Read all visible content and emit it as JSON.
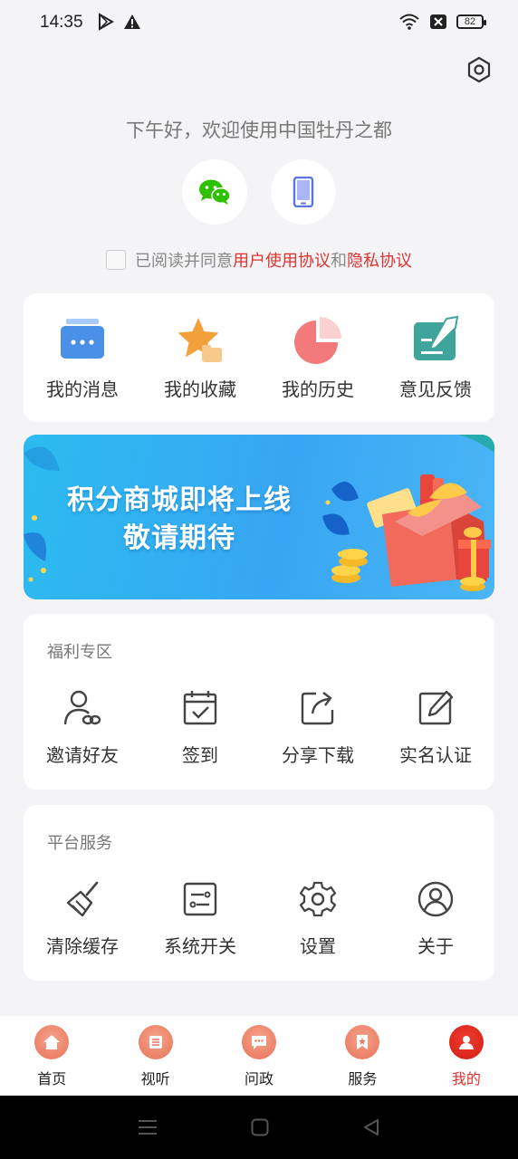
{
  "status": {
    "time": "14:35",
    "battery": "82"
  },
  "greeting": "下午好，欢迎使用中国牡丹之都",
  "agreement": {
    "prefix": "已阅读并同意",
    "user_agreement": "用户使用协议",
    "and": "和",
    "privacy": "隐私协议"
  },
  "quick": [
    {
      "label": "我的消息",
      "icon": "message-icon"
    },
    {
      "label": "我的收藏",
      "icon": "star-folder-icon"
    },
    {
      "label": "我的历史",
      "icon": "pie-history-icon"
    },
    {
      "label": "意见反馈",
      "icon": "feedback-icon"
    }
  ],
  "banner": {
    "line1": "积分商城即将上线",
    "line2": "敬请期待"
  },
  "welfare": {
    "title": "福利专区",
    "items": [
      {
        "label": "邀请好友",
        "icon": "invite-friend-icon"
      },
      {
        "label": "签到",
        "icon": "calendar-check-icon"
      },
      {
        "label": "分享下载",
        "icon": "share-icon"
      },
      {
        "label": "实名认证",
        "icon": "edit-icon"
      }
    ]
  },
  "platform": {
    "title": "平台服务",
    "items": [
      {
        "label": "清除缓存",
        "icon": "broom-icon"
      },
      {
        "label": "系统开关",
        "icon": "toggle-list-icon"
      },
      {
        "label": "设置",
        "icon": "gear-icon"
      },
      {
        "label": "关于",
        "icon": "user-circle-icon"
      }
    ]
  },
  "tabs": [
    {
      "label": "首页",
      "icon": "home-icon"
    },
    {
      "label": "视听",
      "icon": "video-icon"
    },
    {
      "label": "问政",
      "icon": "chat-icon"
    },
    {
      "label": "服务",
      "icon": "service-icon"
    },
    {
      "label": "我的",
      "icon": "profile-icon",
      "active": true
    }
  ],
  "colors": {
    "accent": "#e0332f",
    "background": "#f4f4f6",
    "banner": "#38a6f2",
    "wechat": "#2dc100"
  }
}
